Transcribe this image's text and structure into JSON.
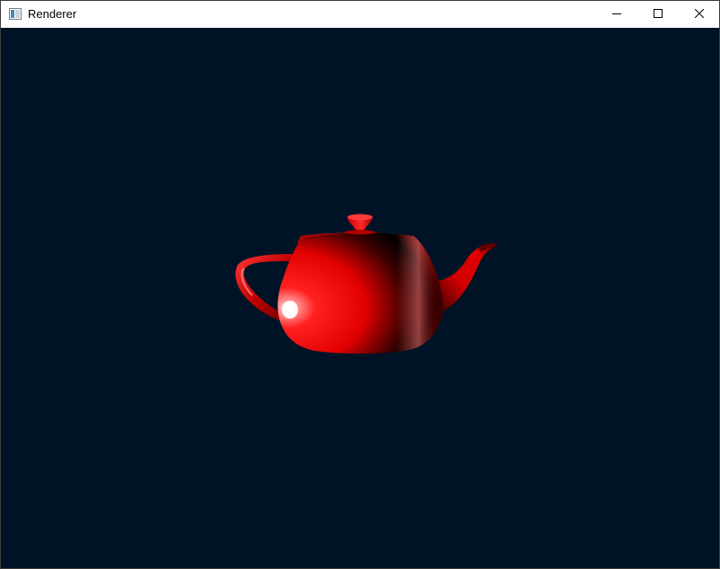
{
  "window": {
    "title": "Renderer",
    "app_icon": "window-app-icon",
    "controls": {
      "minimize_icon": "minimize-icon",
      "maximize_icon": "maximize-icon",
      "close_icon": "close-icon"
    }
  },
  "scene": {
    "background_color": "#001326",
    "object": "teapot",
    "object_color": "#e00000",
    "highlight_color": "#ffffff",
    "shadow_color": "#000000"
  }
}
